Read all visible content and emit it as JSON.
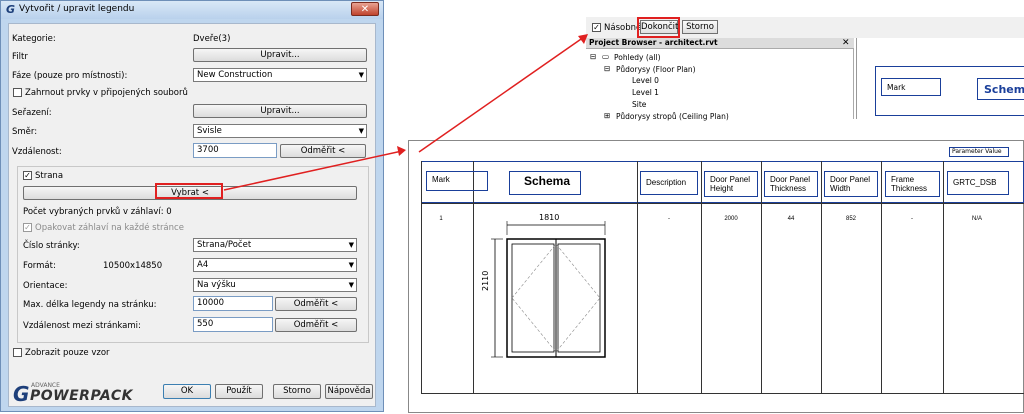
{
  "dialog": {
    "title": "Vytvořit / upravit legendu",
    "close": "✕",
    "kategorie_label": "Kategorie:",
    "kategorie_value": "Dveře(3)",
    "filtr_label": "Filtr",
    "upravit_label": "Upravit...",
    "faze_label": "Fáze (pouze pro místnosti):",
    "faze_value": "New Construction",
    "zahrnout_label": "Zahrnout prvky v připojených souborů",
    "serazeni_label": "Seřazení:",
    "smer_label": "Směr:",
    "smer_value": "Svisle",
    "vzdalenost_label": "Vzdálenost:",
    "vzdalenost_value": "3700",
    "odmerit_label": "Odměřit <",
    "strana_label": "Strana",
    "vybrat_label": "Vybrat <",
    "pocet_label": "Počet vybraných prvků v záhlaví: 0",
    "opakovat_label": "Opakovat záhlaví na každé stránce",
    "cislo_label": "Číslo stránky:",
    "cislo_value": "Strana/Počet",
    "format_label": "Formát:",
    "format_size": "10500x14850",
    "format_value": "A4",
    "orientace_label": "Orientace:",
    "orientace_value": "Na výšku",
    "max_label": "Max. délka legendy na stránku:",
    "max_value": "10000",
    "mezi_label": "Vzdálenost mezi stránkami:",
    "mezi_value": "550",
    "vzor_label": "Zobrazit pouze vzor",
    "ok_label": "OK",
    "pouzit_label": "Použít",
    "storno_label": "Storno",
    "napoveda_label": "Nápověda",
    "logo_small": "ADVANCE",
    "logo_main": "POWERPACK",
    "logo_letter": "G"
  },
  "toolbar": {
    "nasobne_label": "Násobně",
    "dokoncit_label": "Dokončit",
    "storno_label": "Storno"
  },
  "project_browser": {
    "title": "Project Browser - architect.rvt",
    "close": "✕",
    "items": [
      "Pohledy (all)",
      "Půdorysy (Floor Plan)",
      "Level 0",
      "Level 1",
      "Site",
      "Půdorysy stropů (Ceiling Plan)"
    ]
  },
  "canvas_top": {
    "mark": "Mark",
    "schema": "Schema"
  },
  "schedule": {
    "param_value": "Parameter Value",
    "headers": [
      "Mark",
      "Schema",
      "Description",
      "Door Panel Height",
      "Door Panel Thickness",
      "Door Panel Width",
      "Frame Thickness",
      "GRTC_DSB"
    ],
    "row": [
      "1",
      "-",
      "2000",
      "44",
      "852",
      "-",
      "N/A"
    ],
    "dim_width": "1810",
    "dim_height": "2110"
  },
  "colors": {
    "highlight": "#e02020",
    "header_border": "#1a3f9a"
  }
}
